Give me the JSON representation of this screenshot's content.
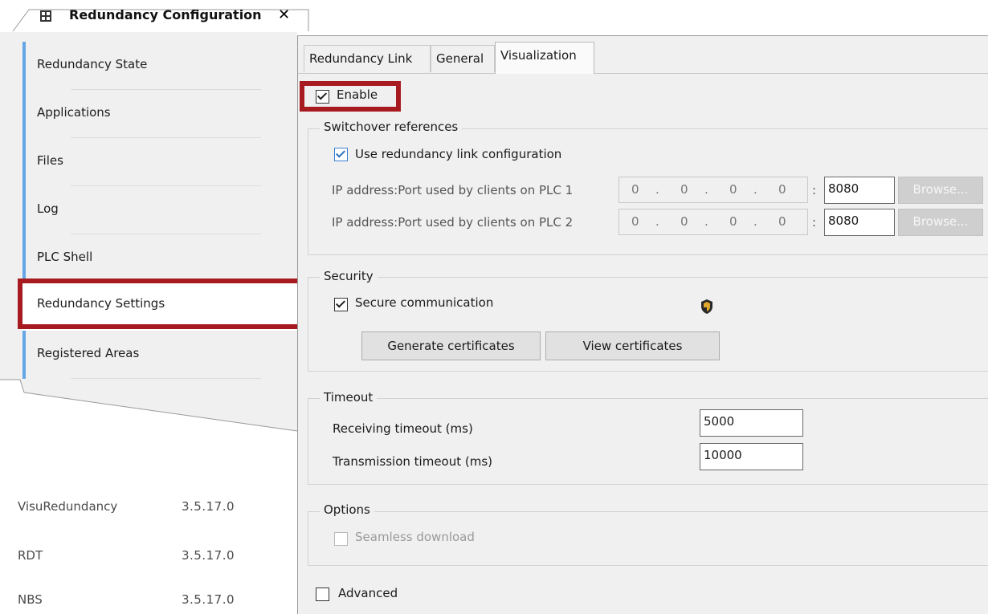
{
  "document_tab": {
    "title": "Redundancy Configuration",
    "close": "✕"
  },
  "sidebar": {
    "items": [
      {
        "label": "Redundancy State"
      },
      {
        "label": "Applications"
      },
      {
        "label": "Files"
      },
      {
        "label": "Log"
      },
      {
        "label": "PLC Shell"
      },
      {
        "label": "Redundancy Settings",
        "active": true
      },
      {
        "label": "Registered Areas"
      }
    ]
  },
  "libraries": [
    {
      "name": "VisuRedundancy",
      "version": "3.5.17.0"
    },
    {
      "name": "RDT",
      "version": "3.5.17.0"
    },
    {
      "name": "NBS",
      "version": "3.5.17.0"
    }
  ],
  "tabs": [
    {
      "label": "Redundancy Link"
    },
    {
      "label": "General"
    },
    {
      "label": "Visualization",
      "selected": true
    }
  ],
  "visualization": {
    "enable": {
      "label": "Enable",
      "checked": true
    },
    "switchover": {
      "title": "Switchover references",
      "use_link_config": {
        "label": "Use redundancy link configuration",
        "checked": true
      },
      "plc1": {
        "label": "IP address:Port used by clients on PLC 1",
        "ip": [
          "0",
          "0",
          "0",
          "0"
        ],
        "colon": ":",
        "port": "8080",
        "browse": "Browse..."
      },
      "plc2": {
        "label": "IP address:Port used by clients on PLC 2",
        "ip": [
          "0",
          "0",
          "0",
          "0"
        ],
        "colon": ":",
        "port": "8080",
        "browse": "Browse..."
      }
    },
    "security": {
      "title": "Security",
      "secure_comm": {
        "label": "Secure communication",
        "checked": true
      },
      "generate_btn": "Generate certificates",
      "view_btn": "View certificates"
    },
    "timeout": {
      "title": "Timeout",
      "receiving": {
        "label": "Receiving timeout  (ms)",
        "value": "5000"
      },
      "transmission": {
        "label": "Transmission timeout (ms)",
        "value": "10000"
      }
    },
    "options": {
      "title": "Options",
      "seamless": {
        "label": "Seamless download",
        "checked": false
      }
    },
    "advanced": {
      "label": "Advanced",
      "checked": false
    }
  },
  "colors": {
    "highlight": "#a71a1f",
    "nav_bar": "#64a6e6",
    "panel_bg": "#f0f0f0"
  }
}
